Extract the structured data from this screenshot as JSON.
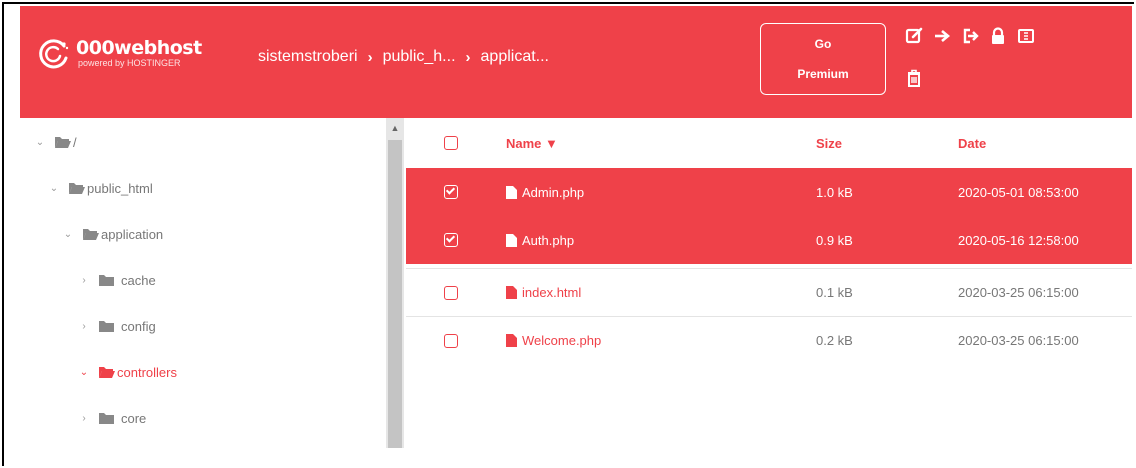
{
  "colors": {
    "accent": "#ef4149",
    "selected_row": "#ef4149",
    "text_muted": "#777777"
  },
  "header": {
    "logo_brand": "000webhost",
    "logo_sub": "powered by HOSTINGER",
    "breadcrumb": [
      "sistemstroberi",
      "public_h...",
      "applicat..."
    ],
    "breadcrumb_separator": "›",
    "premium_line1": "Go",
    "premium_line2": "Premium",
    "toolbar_icons": [
      "edit-icon",
      "move-arrow-icon",
      "exit-icon",
      "lock-icon",
      "archive-icon",
      "trash-icon"
    ]
  },
  "sidebar": {
    "items": [
      {
        "label": "/",
        "arrow": "⌄"
      },
      {
        "label": "public_html",
        "arrow": "⌄"
      },
      {
        "label": "application",
        "arrow": "⌄"
      },
      {
        "label": "cache",
        "arrow": "›"
      },
      {
        "label": "config",
        "arrow": "›"
      },
      {
        "label": "controllers",
        "arrow": "⌄"
      },
      {
        "label": "core",
        "arrow": "›"
      }
    ],
    "scroll_up": "▲"
  },
  "table": {
    "columns": {
      "name": "Name ▼",
      "size": "Size",
      "date": "Date"
    },
    "rows": [
      {
        "name": "Admin.php",
        "size": "1.0 kB",
        "date": "2020-05-01 08:53:00",
        "selected": true
      },
      {
        "name": "Auth.php",
        "size": "0.9 kB",
        "date": "2020-05-16 12:58:00",
        "selected": true
      },
      {
        "name": "index.html",
        "size": "0.1 kB",
        "date": "2020-03-25 06:15:00",
        "selected": false
      },
      {
        "name": "Welcome.php",
        "size": "0.2 kB",
        "date": "2020-03-25 06:15:00",
        "selected": false
      }
    ]
  }
}
